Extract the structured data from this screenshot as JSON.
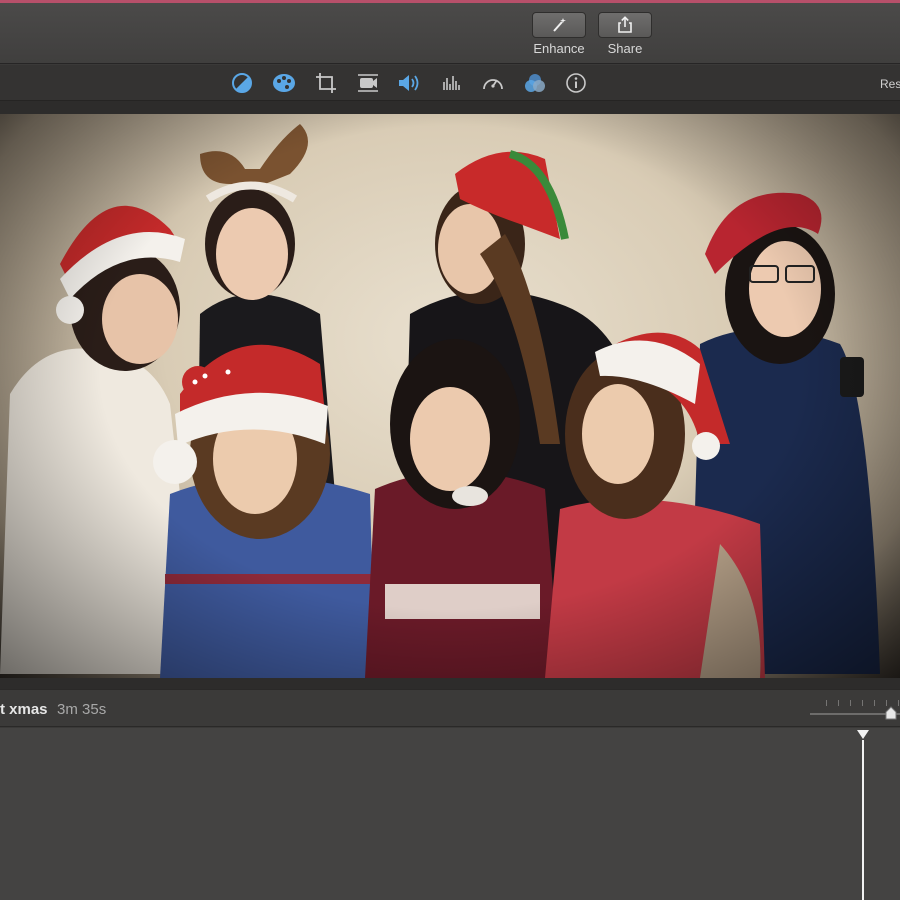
{
  "toolbar": {
    "enhance_label": "Enhance",
    "share_label": "Share",
    "reset_label": "Res",
    "tools": [
      {
        "icon": "color-balance-icon",
        "active": true
      },
      {
        "icon": "color-correction-icon",
        "active": true
      },
      {
        "icon": "crop-icon",
        "active": false
      },
      {
        "icon": "stabilization-icon",
        "active": false
      },
      {
        "icon": "volume-icon",
        "active": true
      },
      {
        "icon": "noise-equalizer-icon",
        "active": false
      },
      {
        "icon": "speed-icon",
        "active": false
      },
      {
        "icon": "clip-filter-icon",
        "active": true
      },
      {
        "icon": "info-icon",
        "active": false
      }
    ]
  },
  "timeline": {
    "project_name": "t xmas",
    "project_duration": "3m 35s",
    "zoom_level": 0.95
  },
  "colors": {
    "accent_blue": "#5aa7e6",
    "icon_gray": "#c9c9c9",
    "top_accent": "#b7506a"
  }
}
